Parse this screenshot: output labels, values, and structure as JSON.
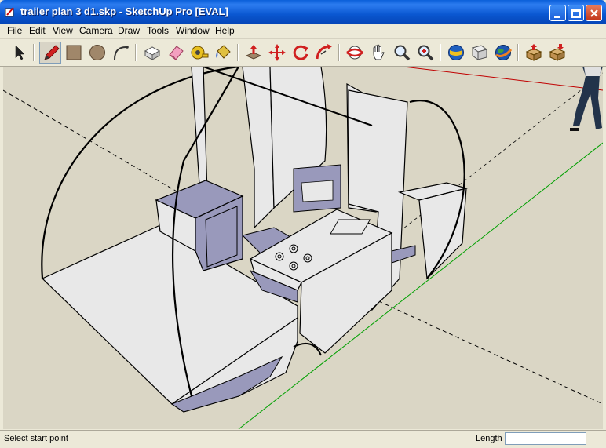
{
  "window": {
    "title": "trailer plan 3 d1.skp - SketchUp Pro [EVAL]"
  },
  "title_buttons": [
    "minimize-icon",
    "maximize-icon",
    "close-icon"
  ],
  "menu": [
    "File",
    "Edit",
    "View",
    "Camera",
    "Draw",
    "Tools",
    "Window",
    "Help"
  ],
  "toolbar": [
    {
      "name": "select-tool",
      "icon": "arrow-cursor-icon"
    },
    {
      "name": "pencil-tool",
      "icon": "pencil-icon",
      "active": true
    },
    {
      "name": "rectangle-tool",
      "icon": "rectangle-icon"
    },
    {
      "name": "circle-tool",
      "icon": "circle-icon"
    },
    {
      "name": "arc-tool",
      "icon": "arc-icon"
    },
    {
      "name": "make-component-tool",
      "icon": "component-icon"
    },
    {
      "name": "eraser-tool",
      "icon": "eraser-icon"
    },
    {
      "name": "tape-measure-tool",
      "icon": "tape-measure-icon"
    },
    {
      "name": "paint-bucket-tool",
      "icon": "paint-bucket-icon"
    },
    {
      "name": "push-pull-tool",
      "icon": "push-pull-icon"
    },
    {
      "name": "move-tool",
      "icon": "move-arrows-icon"
    },
    {
      "name": "rotate-tool",
      "icon": "rotate-icon"
    },
    {
      "name": "follow-me-tool",
      "icon": "follow-me-icon"
    },
    {
      "name": "orbit-tool",
      "icon": "orbit-icon"
    },
    {
      "name": "pan-tool",
      "icon": "hand-icon"
    },
    {
      "name": "zoom-tool",
      "icon": "magnifier-icon"
    },
    {
      "name": "zoom-extents-tool",
      "icon": "zoom-extents-icon"
    },
    {
      "name": "get-models-tool",
      "icon": "warehouse-globe-icon"
    },
    {
      "name": "share-model-tool",
      "icon": "share-model-icon"
    },
    {
      "name": "google-earth-tool",
      "icon": "earth-icon"
    },
    {
      "name": "get-components-tool",
      "icon": "box-download-icon"
    },
    {
      "name": "share-component-tool",
      "icon": "box-upload-icon"
    }
  ],
  "status": {
    "message": "Select start point",
    "length_label": "Length",
    "length_value": ""
  },
  "colors": {
    "viewport_bg": "#DAD6C5",
    "face_light": "#E8E8E8",
    "face_back": "#9999BB",
    "axis_red": "#C00000",
    "axis_green": "#00A000"
  }
}
